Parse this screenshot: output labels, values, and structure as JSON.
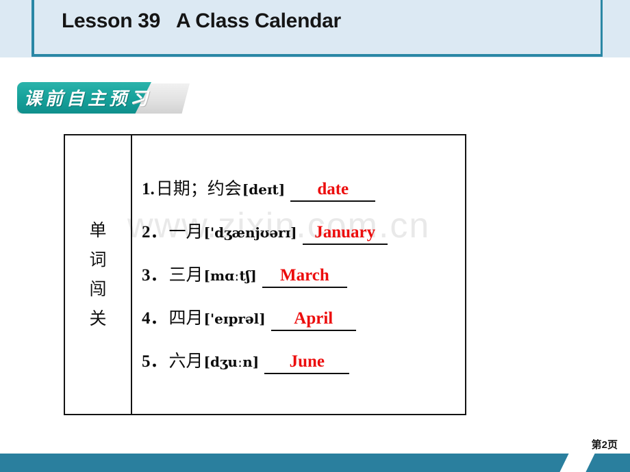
{
  "slide": {
    "header": {
      "title": "Lesson 39   A Class Calendar",
      "accent_color": "#2a87a5",
      "background_color": "#dce9f3"
    },
    "section_banner": {
      "text_main": "课前自主预",
      "text_tail": "习",
      "full_text": "课前自主预习",
      "color": "#18a39c"
    },
    "watermark": "www.zixin.com.cn",
    "table": {
      "row_label": "单\n词\n闯\n关",
      "items": [
        {
          "number": "1.",
          "chinese": "日期；约会",
          "ipa": "[deɪt]",
          "answer": "date"
        },
        {
          "number": "2．",
          "chinese": "一月",
          "ipa": "['dʒænjʊərɪ]",
          "answer": "January"
        },
        {
          "number": "3．",
          "chinese": "三月",
          "ipa": "[mɑːtʃ]",
          "answer": "March"
        },
        {
          "number": "4．",
          "chinese": "四月",
          "ipa": "['eɪprəl]",
          "answer": "April"
        },
        {
          "number": "5．",
          "chinese": "六月",
          "ipa": "[dʒuːn]",
          "answer": "June"
        }
      ],
      "answer_color": "#ec0d0d"
    },
    "footer": {
      "page_label": "第2页",
      "bar_color": "#2a7f9e"
    }
  }
}
